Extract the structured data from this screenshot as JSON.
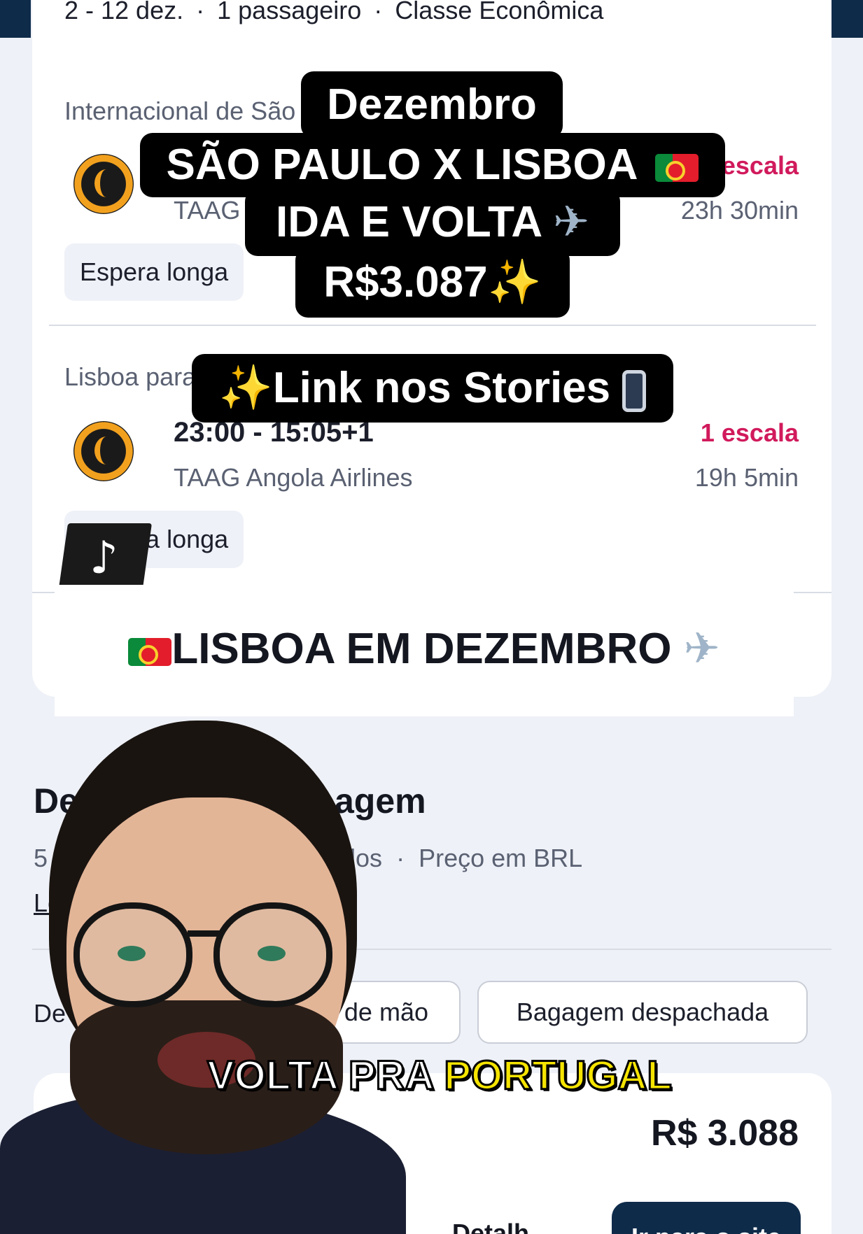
{
  "search_summary": {
    "dates": "2 - 12 dez.",
    "passengers": "1 passageiro",
    "cabin": "Classe Econômica",
    "separator": "·"
  },
  "flights": [
    {
      "route_label": "Internacional de São Paulo para Lisboa",
      "times": "",
      "airline": "TAAG Angola Airlines",
      "stops": "1 escala",
      "duration": "23h 30min",
      "badge": "Espera longa"
    },
    {
      "route_label": "Lisboa para São Paulo",
      "times": "23:00 - 15:05+1",
      "airline": "TAAG Angola Airlines",
      "stops": "1 escala",
      "duration": "19h 5min",
      "badge": "Espera longa"
    }
  ],
  "overlay": {
    "line1": "Dezembro",
    "line2": "SÃO PAULO X LISBOA",
    "line3": "IDA E VOLTA",
    "line4": "R$3.087",
    "stories": "Link nos Stories",
    "banner": "LISBOA EM DEZEMBRO",
    "caption_part1": "VOLTA PRA",
    "caption_part2": "PORTUGAL"
  },
  "details": {
    "title_visible_start": "Det",
    "title_visible_end": "agem",
    "sources_start": "5 f",
    "sources_end": "dos",
    "price_currency_note": "Preço em BRL",
    "link_start": "Le",
    "tab_partial_start": "De",
    "tab_carry_on_partial": "m de mão",
    "tab_checked": "Bagagem despachada"
  },
  "footer": {
    "price": "R$ 3.088",
    "details_link_partial": "Detalh",
    "buy_button_partial": "Ir para o site"
  },
  "colors": {
    "accent_pink": "#d11a5c",
    "navy": "#0f2b4a",
    "background": "#eef1f7"
  },
  "icons": [
    "taag-airline-logo",
    "tiktok-logo",
    "portugal-flag",
    "airplane-emoji",
    "sparkles-emoji",
    "phone-arrow-emoji"
  ]
}
